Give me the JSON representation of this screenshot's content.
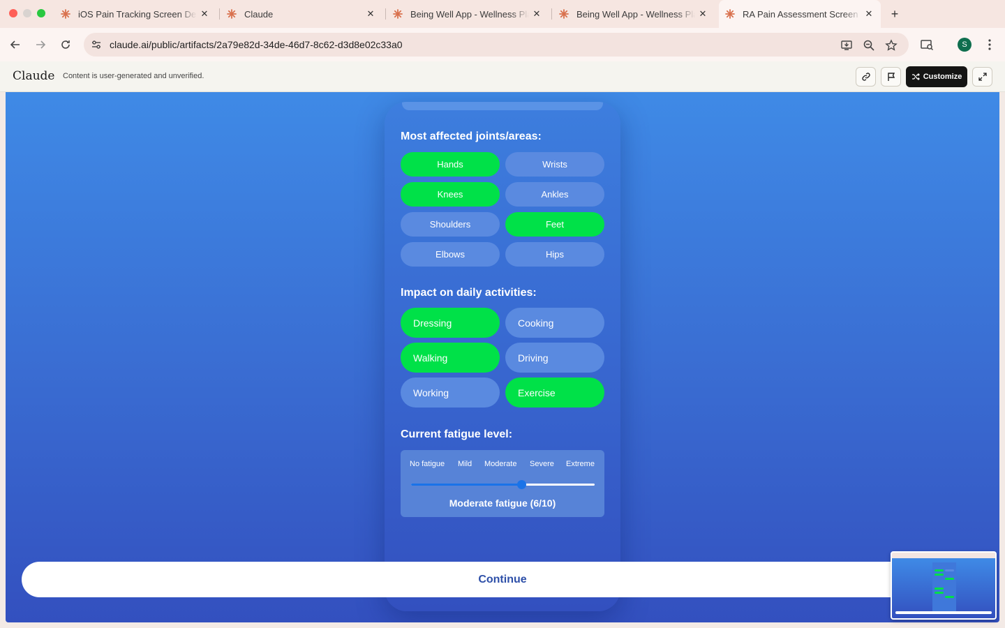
{
  "browser": {
    "tabs": [
      {
        "title": "iOS Pain Tracking Screen Des",
        "active": false
      },
      {
        "title": "Claude",
        "active": false
      },
      {
        "title": "Being Well App - Wellness Pla",
        "active": false
      },
      {
        "title": "Being Well App - Wellness Pla",
        "active": false
      },
      {
        "title": "RA Pain Assessment Screen |",
        "active": true
      }
    ],
    "url": "claude.ai/public/artifacts/2a79e82d-34de-46d7-8c62-d3d8e02c33a0",
    "profile_initial": "S"
  },
  "claude_header": {
    "logo": "Claude",
    "note": "Content is user-generated and unverified.",
    "customize_label": "Customize"
  },
  "app": {
    "joints": {
      "title": "Most affected joints/areas:",
      "items": [
        {
          "label": "Hands",
          "selected": true
        },
        {
          "label": "Wrists",
          "selected": false
        },
        {
          "label": "Knees",
          "selected": true
        },
        {
          "label": "Ankles",
          "selected": false
        },
        {
          "label": "Shoulders",
          "selected": false
        },
        {
          "label": "Feet",
          "selected": true
        },
        {
          "label": "Elbows",
          "selected": false
        },
        {
          "label": "Hips",
          "selected": false
        }
      ]
    },
    "activities": {
      "title": "Impact on daily activities:",
      "items": [
        {
          "label": "Dressing",
          "selected": true
        },
        {
          "label": "Cooking",
          "selected": false
        },
        {
          "label": "Walking",
          "selected": true
        },
        {
          "label": "Driving",
          "selected": false
        },
        {
          "label": "Working",
          "selected": false
        },
        {
          "label": "Exercise",
          "selected": true
        }
      ]
    },
    "fatigue": {
      "title": "Current fatigue level:",
      "labels": [
        "No fatigue",
        "Mild",
        "Moderate",
        "Severe",
        "Extreme"
      ],
      "value": 6,
      "max": 10,
      "value_text": "Moderate fatigue (6/10)"
    },
    "continue_label": "Continue"
  },
  "colors": {
    "selected": "#00e148",
    "unselected": "#5a8ae0",
    "slider": "#1a73e8"
  }
}
